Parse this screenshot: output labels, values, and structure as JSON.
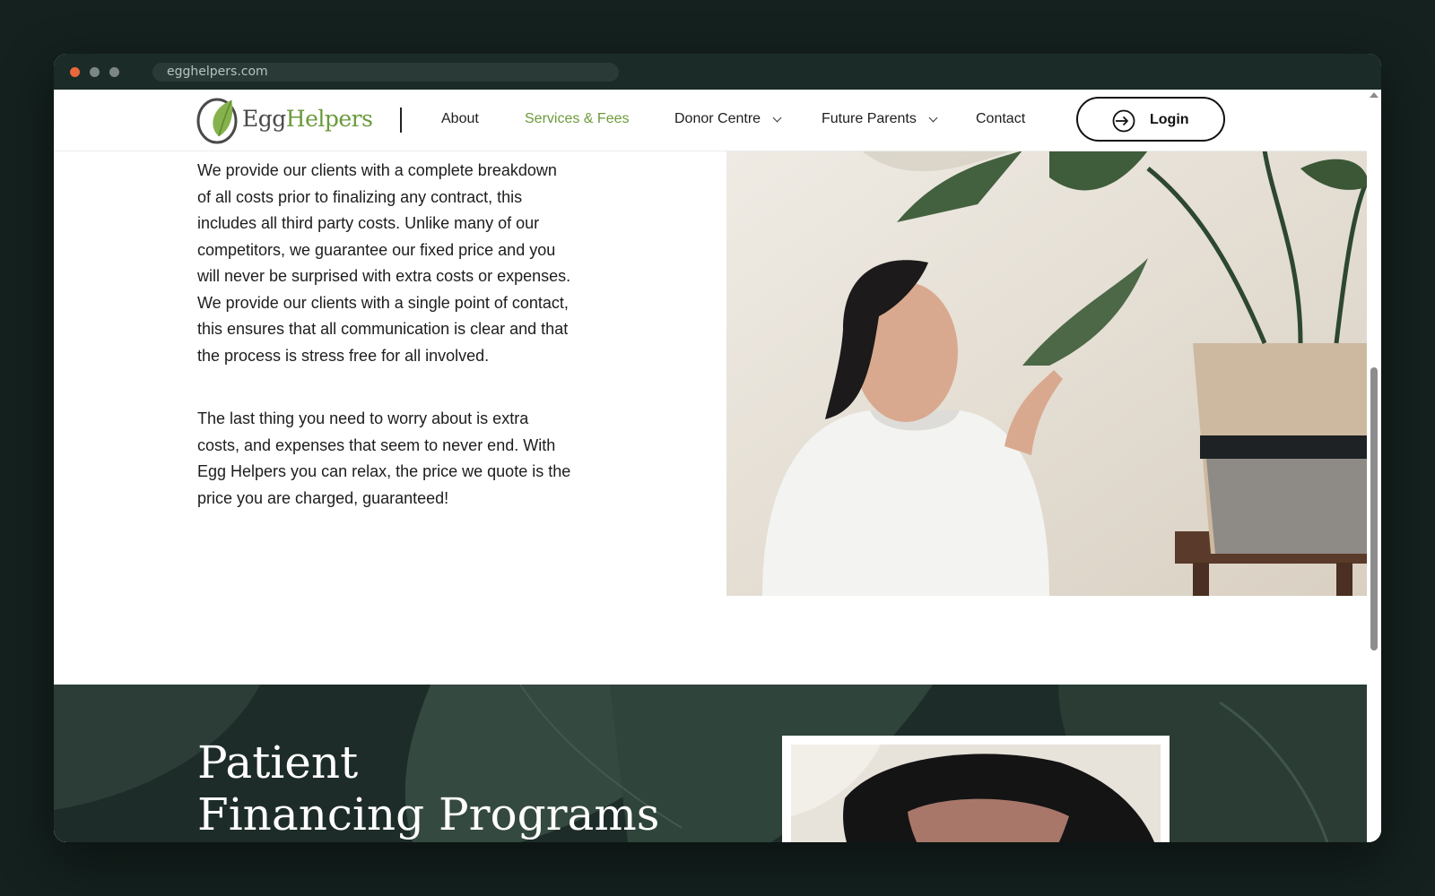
{
  "browser": {
    "url": "egghelpers.com"
  },
  "header": {
    "logo": {
      "word1": "Egg",
      "word2": "Helpers"
    },
    "nav": [
      {
        "label": "About",
        "active": false,
        "dropdown": false
      },
      {
        "label": "Services & Fees",
        "active": true,
        "dropdown": false
      },
      {
        "label": "Donor Centre",
        "active": false,
        "dropdown": true
      },
      {
        "label": "Future Parents",
        "active": false,
        "dropdown": true
      },
      {
        "label": "Contact",
        "active": false,
        "dropdown": false
      }
    ],
    "login_label": "Login"
  },
  "content": {
    "paragraph1": "We provide our clients with a complete breakdown of all costs prior to finalizing any contract, this includes all third party costs. Unlike many of our competitors, we guarantee our fixed price and you will never be surprised with extra costs or expenses. We provide our clients with a single point of contact, this ensures that all communication is clear and that the process is stress free for all involved.",
    "paragraph2": "The last thing you need to worry about is extra costs, and expenses that seem to never end. With Egg Helpers you can relax, the price we quote is the price you are charged, guaranteed!"
  },
  "financing": {
    "title_line1": "Patient",
    "title_line2": "Financing Programs"
  },
  "colors": {
    "brand_green": "#6e9a3c",
    "dark_band": "#1d2c28",
    "page_background": "#14211e"
  }
}
